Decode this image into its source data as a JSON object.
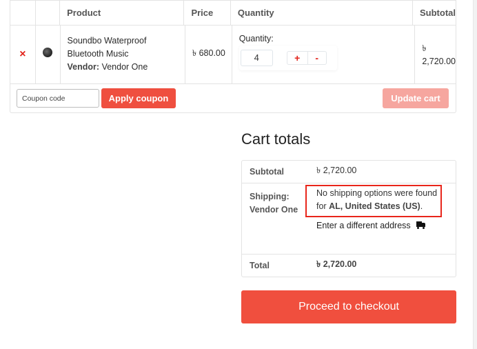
{
  "cart": {
    "headers": {
      "remove": "",
      "thumbnail": "",
      "product": "Product",
      "price": "Price",
      "quantity": "Quantity",
      "subtotal": "Subtotal"
    },
    "items": [
      {
        "remove_icon": "×",
        "thumbnail_icon": "speaker-image",
        "name": "Soundbo Waterproof Bluetooth Music",
        "vendor_label": "Vendor:",
        "vendor_name": "Vendor One",
        "price": "৳ 680.00",
        "quantity_label": "Quantity:",
        "quantity": "4",
        "plus_label": "+",
        "minus_label": "-",
        "subtotal": "৳ 2,720.00"
      }
    ],
    "coupon": {
      "placeholder": "Coupon code",
      "value": "",
      "apply_label": "Apply coupon"
    },
    "update_label": "Update cart"
  },
  "totals": {
    "title": "Cart totals",
    "subtotal_label": "Subtotal",
    "subtotal_value": "৳ 2,720.00",
    "shipping_label_1": "Shipping:",
    "shipping_label_2": "Vendor One",
    "shipping_msg_prefix": "No shipping options were found for ",
    "shipping_msg_location": "AL, United States (US)",
    "shipping_msg_suffix": ".",
    "different_address_label": "Enter a different address",
    "total_label": "Total",
    "total_value": "৳ 2,720.00"
  },
  "checkout_label": "Proceed to checkout",
  "colors": {
    "accent": "#f04f3e",
    "accent_disabled": "#f6a69f",
    "remove": "#e2231a",
    "highlight_box": "#e8251a"
  }
}
